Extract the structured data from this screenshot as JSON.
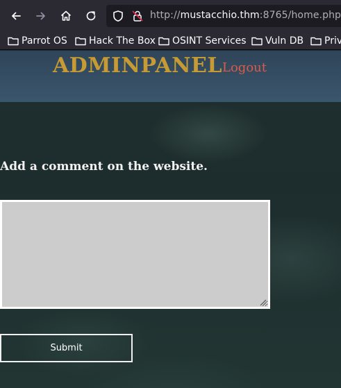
{
  "browser": {
    "url": {
      "scheme": "http://",
      "host": "mustacchio.thm",
      "rest": ":8765/home.php"
    },
    "nav_icons": [
      "back-icon",
      "forward-icon",
      "home-icon",
      "reload-icon"
    ],
    "bookmarks": [
      {
        "label": "Parrot OS"
      },
      {
        "label": "Hack The Box"
      },
      {
        "label": "OSINT Services"
      },
      {
        "label": "Vuln DB"
      },
      {
        "label": "Priv"
      }
    ]
  },
  "page": {
    "brand": "ADMINPANEL",
    "logout": "Logout",
    "heading": "Add a comment on the website.",
    "comment_value": "",
    "submit_label": "Submit"
  },
  "colors": {
    "brand": "#c69a34",
    "logout": "#d95b4a",
    "chrome_bg": "#2b2a33",
    "urlbar_bg": "#1c1b22",
    "textarea_bg": "#cccccc"
  }
}
